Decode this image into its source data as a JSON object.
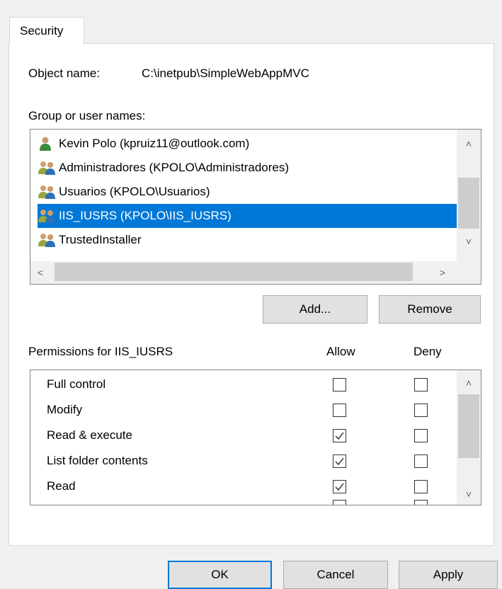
{
  "tabs": [
    {
      "label": "Security"
    }
  ],
  "object": {
    "label": "Object name:",
    "value": "C:\\inetpub\\SimpleWebAppMVC"
  },
  "users": {
    "label": "Group or user names:",
    "items": [
      {
        "name": "Kevin Polo (kpruiz11@outlook.com)",
        "icon": "user-icon",
        "selected": false
      },
      {
        "name": "Administradores (KPOLO\\Administradores)",
        "icon": "users-group-icon",
        "selected": false
      },
      {
        "name": "Usuarios (KPOLO\\Usuarios)",
        "icon": "users-group-icon",
        "selected": false
      },
      {
        "name": "IIS_IUSRS (KPOLO\\IIS_IUSRS)",
        "icon": "users-group-icon",
        "selected": true
      },
      {
        "name": "TrustedInstaller",
        "icon": "users-group-icon",
        "selected": false
      }
    ]
  },
  "buttons": {
    "add": "Add...",
    "remove": "Remove",
    "ok": "OK",
    "cancel": "Cancel",
    "apply": "Apply"
  },
  "permissions": {
    "title": "Permissions for IIS_IUSRS",
    "allow_label": "Allow",
    "deny_label": "Deny",
    "rows": [
      {
        "name": "Full control",
        "allow": false,
        "deny": false
      },
      {
        "name": "Modify",
        "allow": false,
        "deny": false
      },
      {
        "name": "Read & execute",
        "allow": true,
        "deny": false
      },
      {
        "name": "List folder contents",
        "allow": true,
        "deny": false
      },
      {
        "name": "Read",
        "allow": true,
        "deny": false
      }
    ]
  },
  "colors": {
    "selection": "#0078d7",
    "default_button_border": "#0078d7"
  }
}
